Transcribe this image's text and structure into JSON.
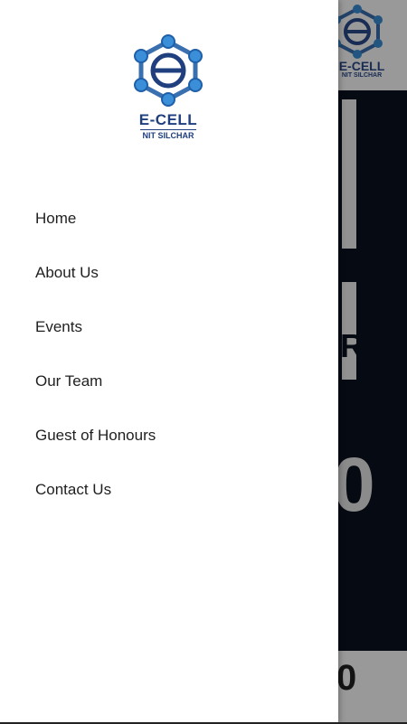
{
  "brand": {
    "title": "E-CELL",
    "subtitle": "NIT SILCHAR",
    "logo_icon": "ecell-hexagon-logo",
    "colors": {
      "primary": "#1f3f7f",
      "node": "#3a8fd8"
    }
  },
  "nav": {
    "items": [
      {
        "label": "Home"
      },
      {
        "label": "About Us"
      },
      {
        "label": "Events"
      },
      {
        "label": "Our Team"
      },
      {
        "label": "Guest of Honours"
      },
      {
        "label": "Contact Us"
      }
    ]
  },
  "background": {
    "header_logo_title": "E-CELL",
    "header_logo_subtitle": "NIT SILCHAR",
    "hero_glyph": "R",
    "hero_number": "0",
    "footer_number": "0",
    "hero_color": "#0b1220"
  }
}
